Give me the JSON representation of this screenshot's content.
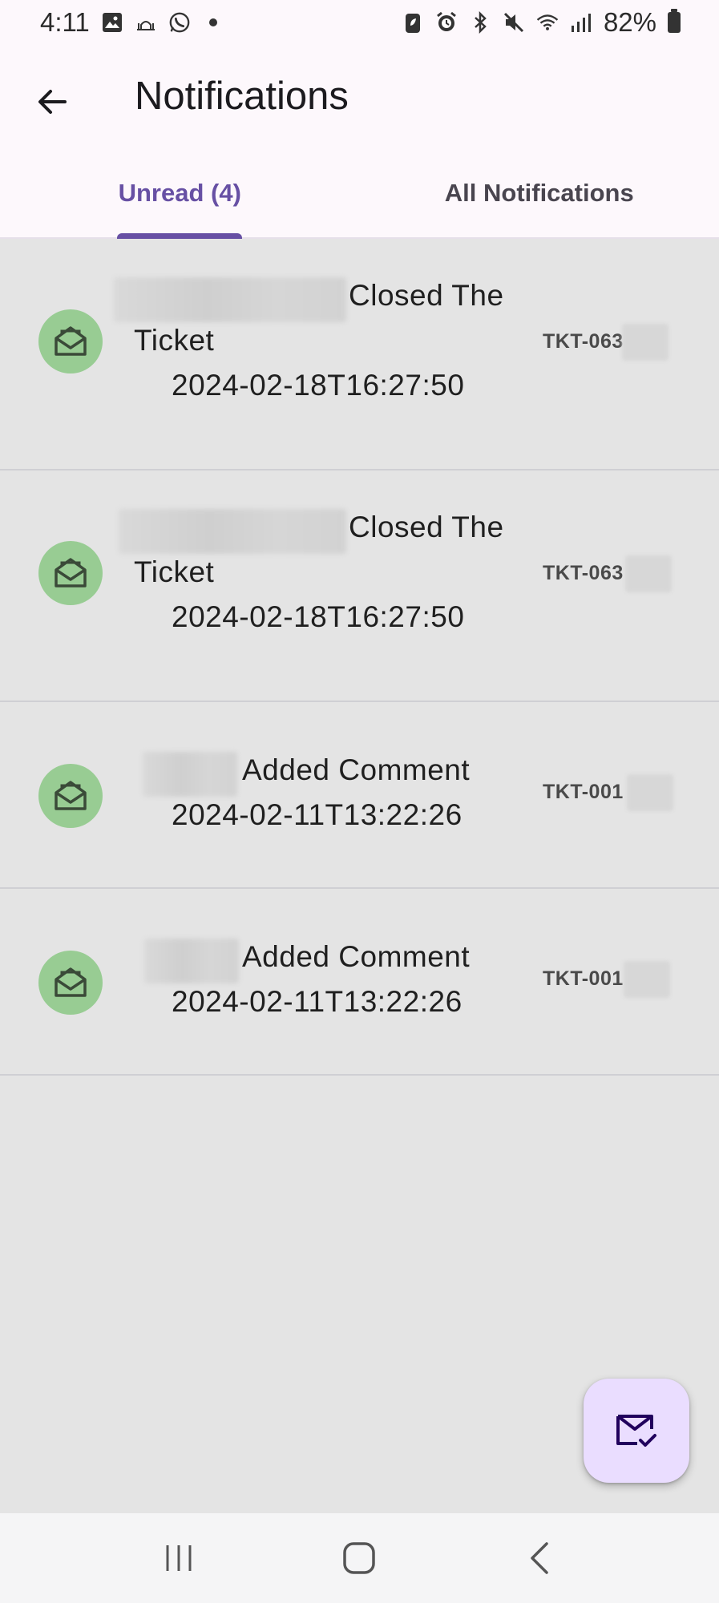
{
  "status_bar": {
    "time": "4:11",
    "battery": "82%",
    "left_icons": [
      "gallery-icon",
      "mosque-icon",
      "whatsapp-icon",
      "dot-icon"
    ],
    "right_icons": [
      "battery-saver-icon",
      "alarm-icon",
      "bluetooth-icon",
      "mute-icon",
      "wifi-icon",
      "signal-icon",
      "battery-icon"
    ]
  },
  "header": {
    "title": "Notifications",
    "back_icon": "arrow-left-icon"
  },
  "tabs": [
    {
      "label": "Unread (4)",
      "active": true
    },
    {
      "label": "All Notifications",
      "active": false
    }
  ],
  "notifications": [
    {
      "action": "Closed The",
      "action_line2": "Ticket",
      "timestamp": "2024-02-18T16:27:50",
      "ticket": "TKT-063",
      "icon": "mail-open-icon"
    },
    {
      "action": "Closed The",
      "action_line2": "Ticket",
      "timestamp": "2024-02-18T16:27:50",
      "ticket": "TKT-063",
      "icon": "mail-open-icon"
    },
    {
      "action": "Added Comment",
      "timestamp": "2024-02-11T13:22:26",
      "ticket": "TKT-001",
      "icon": "mail-open-icon"
    },
    {
      "action": "Added Comment",
      "timestamp": "2024-02-11T13:22:26",
      "ticket": "TKT-001",
      "icon": "mail-open-icon"
    }
  ],
  "fab": {
    "icon": "mark-all-read-icon"
  },
  "nav_bar": {
    "buttons": [
      "recent-apps-icon",
      "home-icon",
      "back-icon"
    ]
  },
  "colors": {
    "accent": "#6750a4",
    "avatar_bg": "#98cc93",
    "list_bg": "#e4e4e4",
    "fab_bg": "#eaddff"
  }
}
